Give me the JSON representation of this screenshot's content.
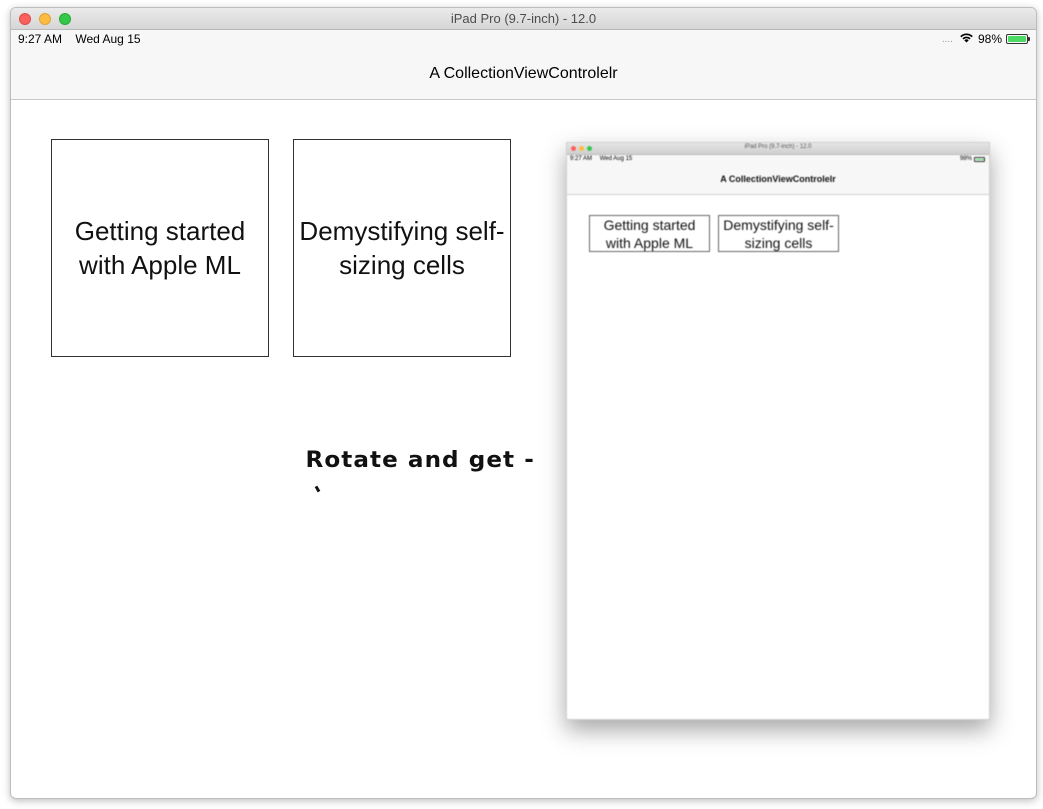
{
  "window": {
    "title": "iPad Pro (9.7-inch) - 12.0"
  },
  "status_bar": {
    "time": "9:27 AM",
    "date": "Wed Aug 15",
    "signal_dots": "....",
    "battery_percent": "98%",
    "battery_level": 0.98
  },
  "nav": {
    "title": "A CollectionViewControlelr"
  },
  "cells": [
    {
      "label": "Getting started\nwith Apple ML"
    },
    {
      "label": "Demystifying self-\nsizing cells"
    }
  ],
  "annotation": {
    "text": "Rotate and get -"
  },
  "embedded_screenshot": {
    "window_title": "iPad Pro (9.7-inch) - 12.0",
    "time": "9:27 AM",
    "date": "Wed Aug 15",
    "battery_percent": "98%",
    "nav_title": "A CollectionViewControlelr",
    "cells": [
      {
        "label": "Getting started\nwith Apple ML"
      },
      {
        "label": "Demystifying self-\nsizing cells"
      }
    ]
  },
  "colors": {
    "close": "#fc605c",
    "minimize": "#fdbc40",
    "maximize": "#34c84a",
    "battery_fill": "#4cd964"
  }
}
